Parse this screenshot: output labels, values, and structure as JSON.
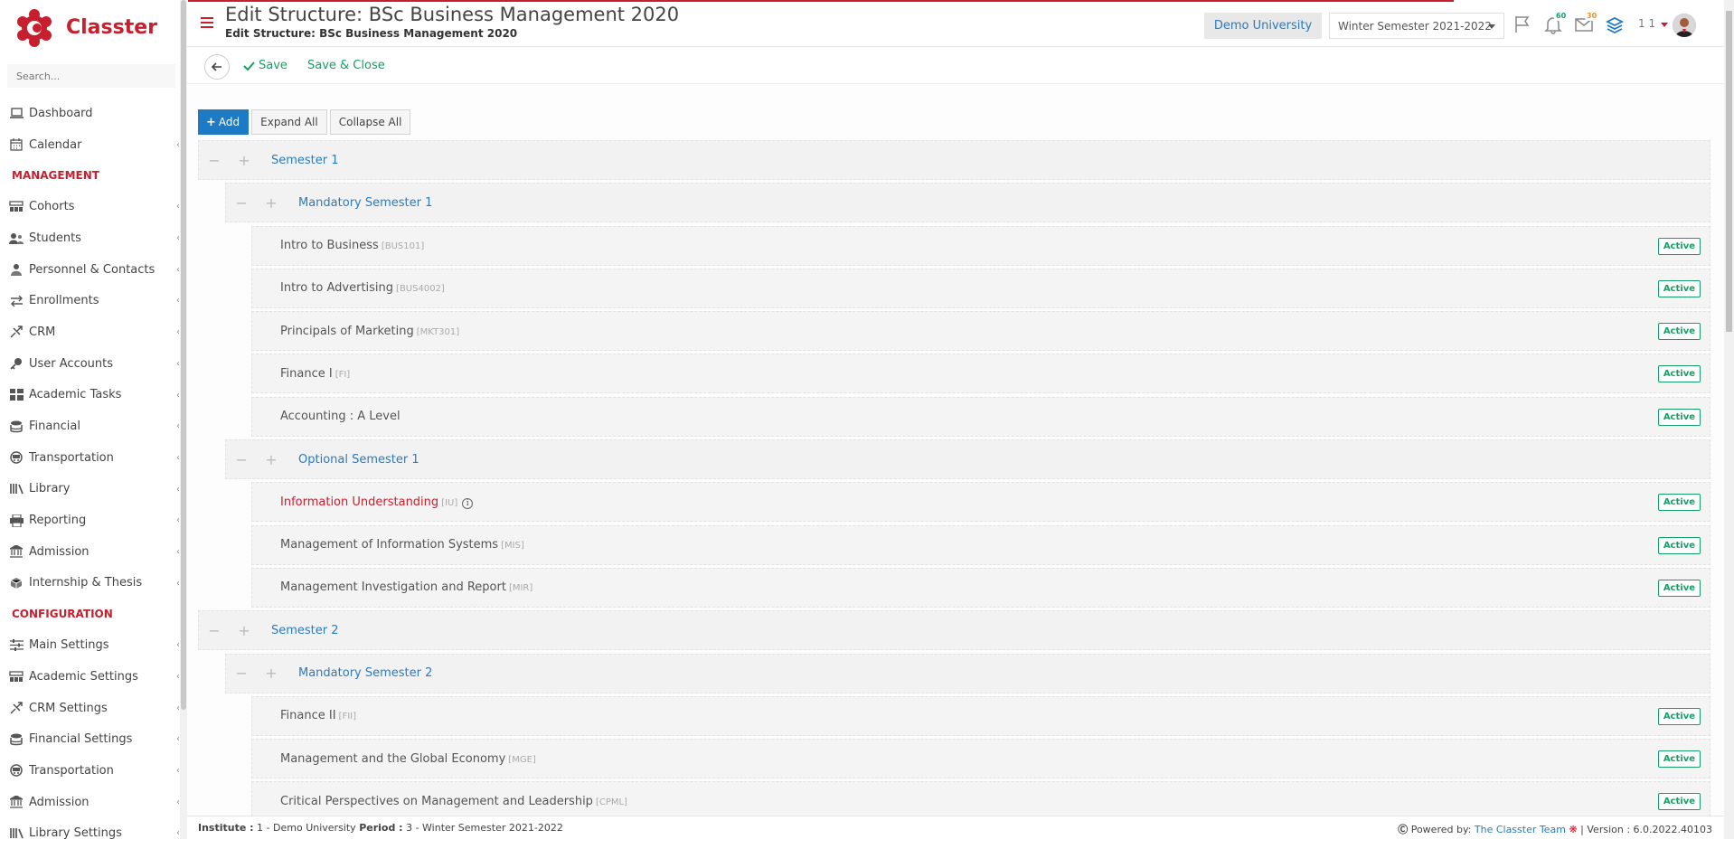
{
  "app": {
    "name": "Classter"
  },
  "sidebar": {
    "search_placeholder": "Search...",
    "items": [
      {
        "label": "Dashboard",
        "icon": "laptop-icon",
        "chev": false
      },
      {
        "label": "Calendar",
        "icon": "calendar-icon",
        "chev": true
      },
      {
        "section": "MANAGEMENT"
      },
      {
        "label": "Cohorts",
        "icon": "cohorts-icon",
        "chev": true
      },
      {
        "label": "Students",
        "icon": "students-icon",
        "chev": true
      },
      {
        "label": "Personnel & Contacts",
        "icon": "personnel-icon",
        "chev": true
      },
      {
        "label": "Enrollments",
        "icon": "enrollments-icon",
        "chev": true
      },
      {
        "label": "CRM",
        "icon": "crm-icon",
        "chev": true
      },
      {
        "label": "User Accounts",
        "icon": "key-icon",
        "chev": true
      },
      {
        "label": "Academic Tasks",
        "icon": "tasks-icon",
        "chev": true
      },
      {
        "label": "Financial",
        "icon": "coins-icon",
        "chev": true
      },
      {
        "label": "Transportation",
        "icon": "bus-icon",
        "chev": true
      },
      {
        "label": "Library",
        "icon": "library-icon",
        "chev": true
      },
      {
        "label": "Reporting",
        "icon": "printer-icon",
        "chev": true
      },
      {
        "label": "Admission",
        "icon": "bank-icon",
        "chev": true
      },
      {
        "label": "Internship & Thesis",
        "icon": "box-icon",
        "chev": true
      },
      {
        "section": "CONFIGURATION"
      },
      {
        "label": "Main Settings",
        "icon": "sliders-icon",
        "chev": true
      },
      {
        "label": "Academic Settings",
        "icon": "cohorts-icon",
        "chev": true
      },
      {
        "label": "CRM Settings",
        "icon": "crm-icon",
        "chev": true
      },
      {
        "label": "Financial Settings",
        "icon": "coins-icon",
        "chev": true
      },
      {
        "label": "Transportation",
        "icon": "bus-icon",
        "chev": true
      },
      {
        "label": "Admission",
        "icon": "bank-icon",
        "chev": true
      },
      {
        "label": "Library Settings",
        "icon": "library-icon",
        "chev": true
      }
    ]
  },
  "header": {
    "title": "Edit Structure: BSc Business Management 2020",
    "subtitle": "Edit Structure: BSc Business Management 2020",
    "institution": "Demo University",
    "period": "Winter Semester 2021-2022",
    "notifications_count": "60",
    "messages_count": "30",
    "user_counter": "1 1"
  },
  "toolbar": {
    "save_label": "Save",
    "save_close_label": "Save & Close"
  },
  "actions": {
    "add_label": "Add",
    "expand_label": "Expand All",
    "collapse_label": "Collapse All"
  },
  "tree": [
    {
      "level": 1,
      "type": "group",
      "name": "Semester 1"
    },
    {
      "level": 2,
      "type": "group",
      "name": "Mandatory Semester 1"
    },
    {
      "level": 3,
      "type": "course",
      "name": "Intro to Business",
      "code": "[BUS101]",
      "status": "Active"
    },
    {
      "level": 3,
      "type": "course",
      "name": "Intro to Advertising",
      "code": "[BUS4002]",
      "status": "Active"
    },
    {
      "level": 3,
      "type": "course",
      "name": "Principals of Marketing",
      "code": "[MKT301]",
      "status": "Active"
    },
    {
      "level": 3,
      "type": "course",
      "name": "Finance I",
      "code": "[FI]",
      "status": "Active"
    },
    {
      "level": 3,
      "type": "course",
      "name": "Accounting : A Level",
      "code": "",
      "status": "Active"
    },
    {
      "level": 2,
      "type": "group",
      "name": "Optional Semester 1"
    },
    {
      "level": 3,
      "type": "course",
      "name": "Information Understanding",
      "code": "[IU]",
      "status": "Active",
      "highlight": true,
      "info": true
    },
    {
      "level": 3,
      "type": "course",
      "name": "Management of Information Systems",
      "code": "[MIS]",
      "status": "Active"
    },
    {
      "level": 3,
      "type": "course",
      "name": "Management Investigation and Report",
      "code": "[MIR]",
      "status": "Active"
    },
    {
      "level": 1,
      "type": "group",
      "name": "Semester 2"
    },
    {
      "level": 2,
      "type": "group",
      "name": "Mandatory Semester 2"
    },
    {
      "level": 3,
      "type": "course",
      "name": "Finance II",
      "code": "[FII]",
      "status": "Active"
    },
    {
      "level": 3,
      "type": "course",
      "name": "Management and the Global Economy",
      "code": "[MGE]",
      "status": "Active"
    },
    {
      "level": 3,
      "type": "course",
      "name": "Critical Perspectives on Management and Leadership",
      "code": "[CPML]",
      "status": "Active"
    }
  ],
  "footer": {
    "institute_label": "Institute :",
    "institute_value": "1 - Demo University",
    "period_label": "Period :",
    "period_value": "3 - Winter Semester 2021-2022",
    "powered_label": "Powered by:",
    "powered_link": "The Classter Team",
    "version": "| Version : 6.0.2022.40103"
  },
  "colors": {
    "brand": "#c61f2e",
    "link": "#2a7bbf",
    "success": "#17a065",
    "primary": "#1f7ac4"
  }
}
